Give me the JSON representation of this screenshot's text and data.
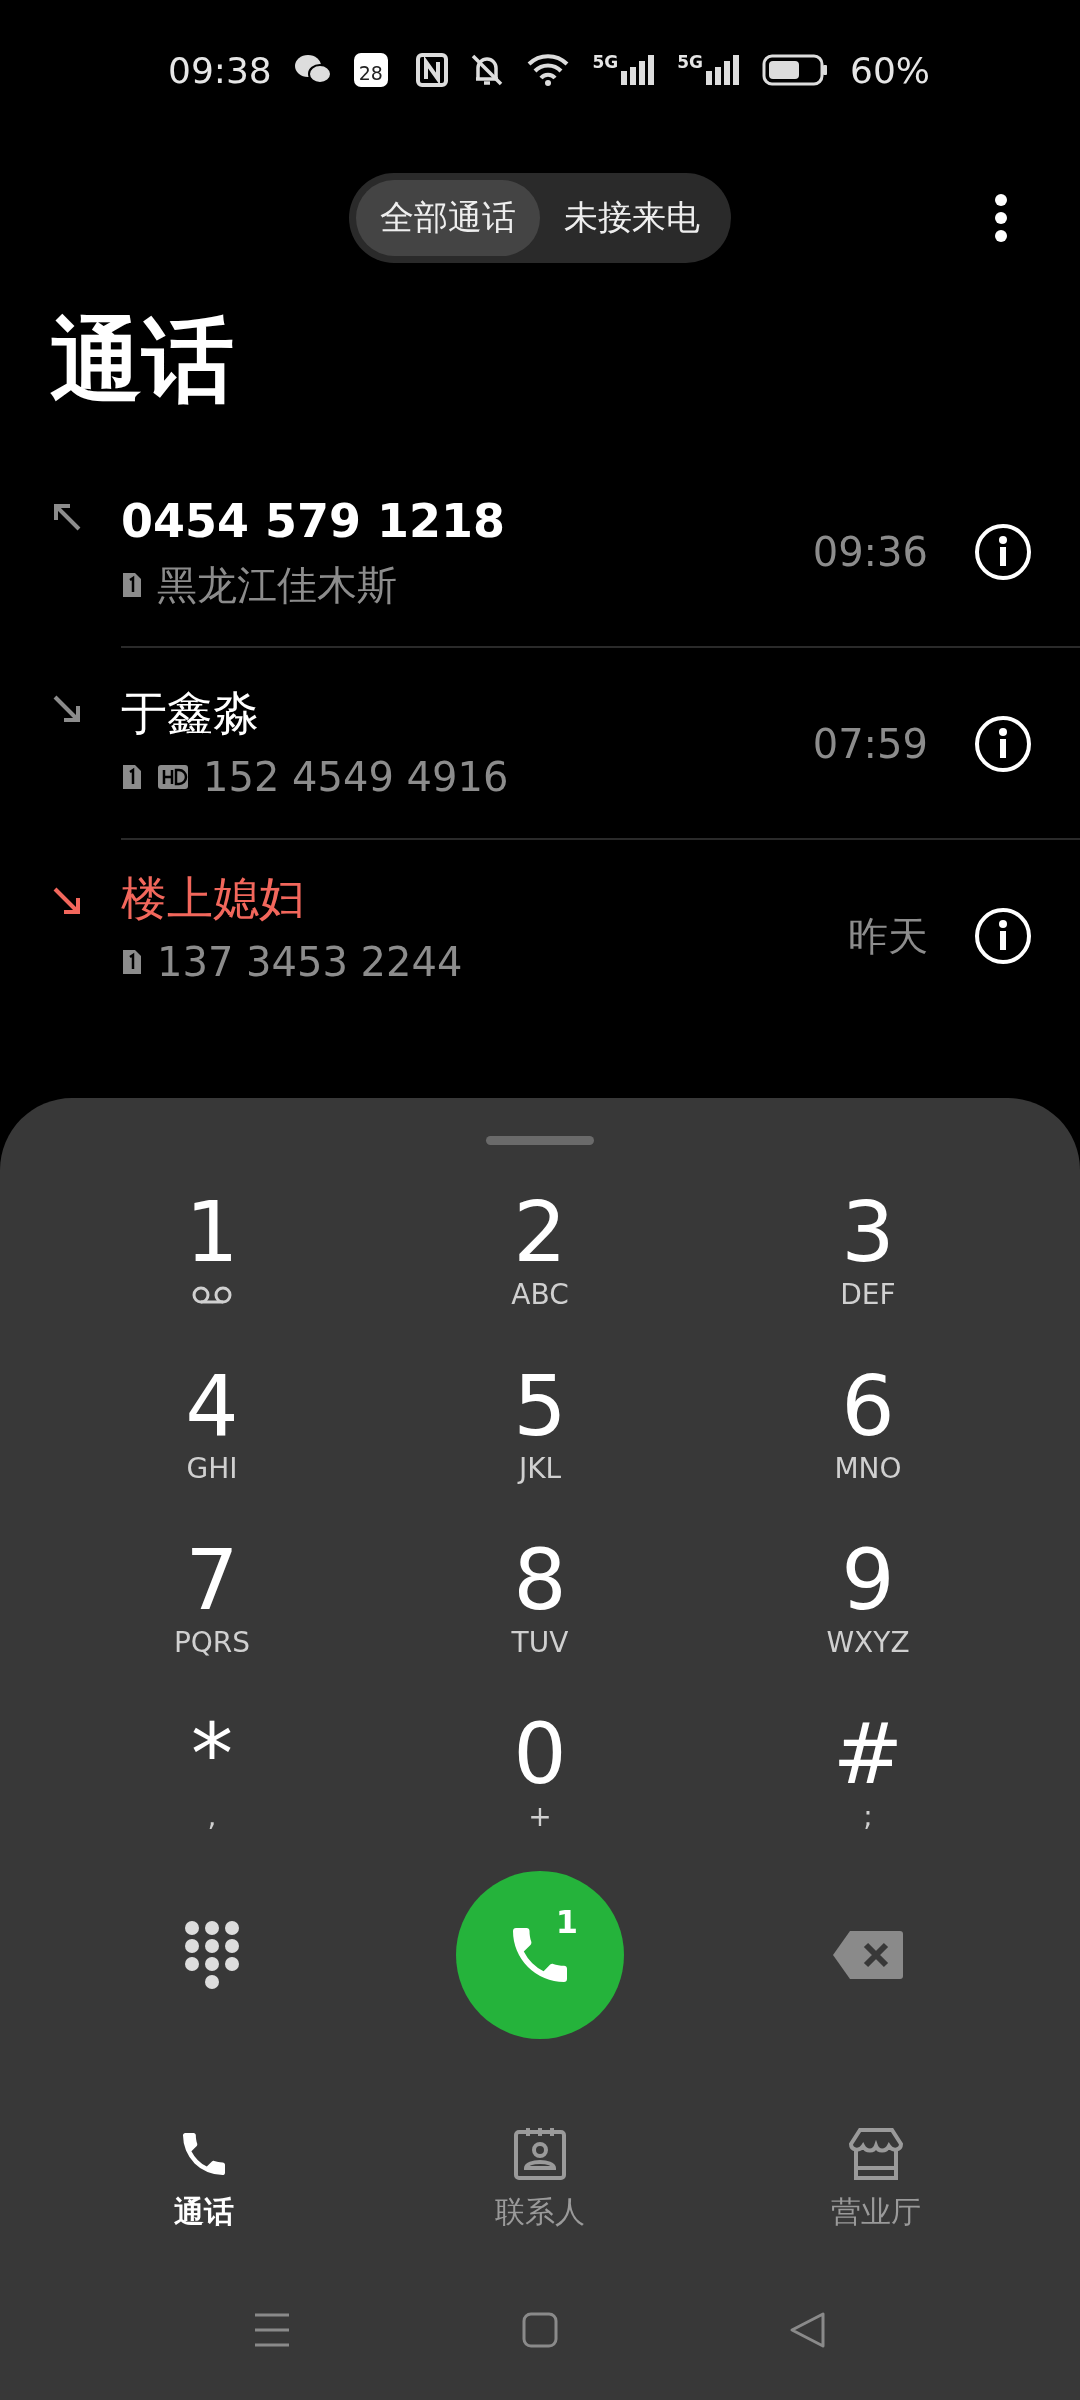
{
  "status_bar": {
    "time": "09:38",
    "calendar_day": "28",
    "networks": [
      "5G",
      "5G"
    ],
    "battery": "60%"
  },
  "filter_tabs": [
    {
      "label": "全部通话",
      "selected": true
    },
    {
      "label": "未接来电",
      "selected": false
    }
  ],
  "title": "通话",
  "calls": [
    {
      "name": "0454 579 1218",
      "kind": "outgoing",
      "missed": false,
      "hd": false,
      "detail": "黑龙江佳木斯",
      "time": "09:36"
    },
    {
      "name": "于鑫淼",
      "kind": "incoming",
      "missed": false,
      "hd": true,
      "detail": "152 4549 4916",
      "time": "07:59"
    },
    {
      "name": "楼上媳妇",
      "kind": "incoming",
      "missed": true,
      "hd": false,
      "detail": "137 3453 2244",
      "time": "昨天"
    }
  ],
  "keypad": [
    {
      "digit": "1",
      "kind": "voicemail"
    },
    {
      "digit": "2",
      "kind": "letters",
      "letters": "ABC"
    },
    {
      "digit": "3",
      "kind": "letters",
      "letters": "DEF"
    },
    {
      "digit": "4",
      "kind": "letters",
      "letters": "GHI"
    },
    {
      "digit": "5",
      "kind": "letters",
      "letters": "JKL"
    },
    {
      "digit": "6",
      "kind": "letters",
      "letters": "MNO"
    },
    {
      "digit": "7",
      "kind": "letters",
      "letters": "PQRS"
    },
    {
      "digit": "8",
      "kind": "letters",
      "letters": "TUV"
    },
    {
      "digit": "9",
      "kind": "letters",
      "letters": "WXYZ"
    },
    {
      "digit": "*",
      "kind": "letters",
      "letters": ","
    },
    {
      "digit": "0",
      "kind": "letters",
      "letters": "+"
    },
    {
      "digit": "#",
      "kind": "letters",
      "letters": ";"
    }
  ],
  "call_button": {
    "sim": "1"
  },
  "bottom_nav": [
    {
      "label": "通话",
      "kind": "phone",
      "selected": true
    },
    {
      "label": "联系人",
      "kind": "contacts",
      "selected": false
    },
    {
      "label": "营业厅",
      "kind": "store",
      "selected": false
    }
  ]
}
